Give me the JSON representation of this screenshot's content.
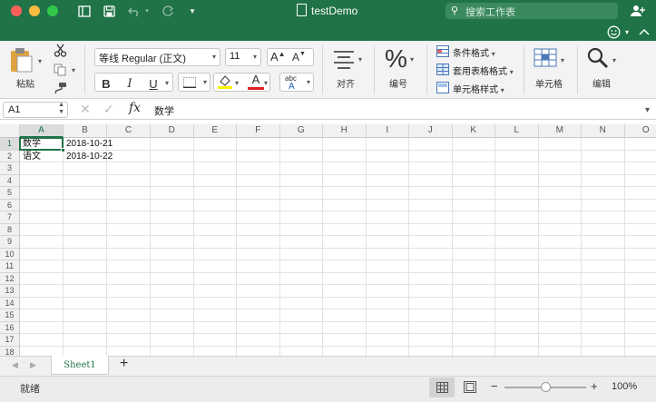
{
  "window": {
    "title": "testDemo"
  },
  "titlebar": {
    "search_placeholder": "搜索工作表"
  },
  "ribbon": {
    "paste_label": "粘贴",
    "font_name": "等线 Regular (正文)",
    "font_size": "11",
    "grow_label": "A",
    "shrink_label": "A",
    "bold_label": "B",
    "italic_label": "I",
    "underline_label": "U",
    "fontcolor_label": "A",
    "abc_label": "abc",
    "align_label": "对齐",
    "number_label": "编号",
    "percent_label": "%",
    "conditional_label": "条件格式",
    "table_format_label": "套用表格格式",
    "cell_style_label": "单元格样式",
    "cells_label": "单元格",
    "edit_label": "编辑"
  },
  "formula_bar": {
    "name_box": "A1",
    "fx_label": "fx",
    "content": "数学"
  },
  "grid": {
    "columns": [
      "A",
      "B",
      "C",
      "D",
      "E",
      "F",
      "G",
      "H",
      "I",
      "J",
      "K",
      "L",
      "M",
      "N",
      "O"
    ],
    "rows": [
      "1",
      "2",
      "3",
      "4",
      "5",
      "6",
      "7",
      "8",
      "9",
      "10",
      "11",
      "12",
      "13",
      "14",
      "15",
      "16",
      "17",
      "18"
    ],
    "cells": [
      {
        "ref": "A1",
        "text": "数学"
      },
      {
        "ref": "B1",
        "text": "2018-10-21"
      },
      {
        "ref": "A2",
        "text": "语文"
      },
      {
        "ref": "B2",
        "text": "2018-10-22"
      }
    ]
  },
  "sheets": {
    "tabs": [
      "Sheet1"
    ],
    "add_label": "+"
  },
  "status": {
    "ready": "就绪",
    "zoom_minus": "−",
    "zoom_plus": "+",
    "zoom": "100%",
    "zoom_level": 0.5
  },
  "colors": {
    "accent": "#1f7346"
  }
}
